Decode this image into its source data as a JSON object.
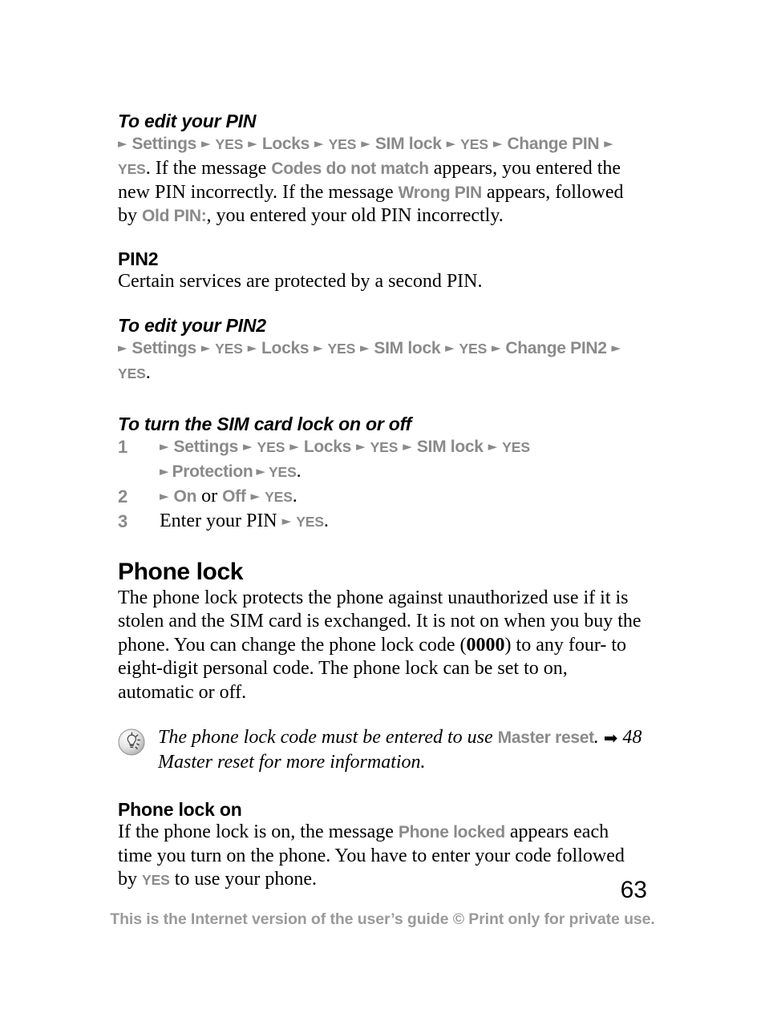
{
  "page": {
    "number": "63",
    "footer_note": "This is the Internet version of the user’s guide © Print only for private use."
  },
  "icons": {
    "menu_arrow": "►",
    "cross_reference_arrow": "➡",
    "tip": "lightbulb-tip-icon"
  },
  "colors": {
    "ui_gray": "#8a8a8a",
    "footer_gray": "#9a9a9a",
    "text_black": "#000000",
    "page_background": "#ffffff"
  },
  "sections": [
    {
      "id": "to-edit-your-pin",
      "heading": "To edit your PIN",
      "menu_path": [
        "Settings",
        "YES",
        "Locks",
        "YES",
        "SIM lock",
        "YES",
        "Change PIN",
        "YES"
      ],
      "body_parts": {
        "t1": ". If the message ",
        "m1": "Codes do not match",
        "t2": " appears, you entered the new PIN incorrectly. If the message ",
        "m2": "Wrong PIN",
        "t3": " appears, followed by ",
        "m3": "Old PIN:",
        "t4": ", you entered your old PIN incorrectly."
      }
    },
    {
      "id": "pin2",
      "heading": "PIN2",
      "body": "Certain services are protected by a second PIN."
    },
    {
      "id": "to-edit-your-pin2",
      "heading": "To edit your PIN2",
      "menu_path": [
        "Settings",
        "YES",
        "Locks",
        "YES",
        "SIM lock",
        "YES",
        "Change PIN2",
        "YES"
      ],
      "trailing": "."
    },
    {
      "id": "to-turn-sim-card-lock",
      "heading": "To turn the SIM card lock on or off",
      "steps": [
        {
          "number": "1",
          "menu_path": [
            "Settings",
            "YES",
            "Locks",
            "YES",
            "SIM lock",
            "YES"
          ],
          "menu_path_cont": [
            "Protection",
            "YES"
          ],
          "trailing": "."
        },
        {
          "number": "2",
          "option_a": "On",
          "conjunction": " or ",
          "option_b": "Off",
          "confirm": "YES",
          "trailing": "."
        },
        {
          "number": "3",
          "text": "Enter your PIN ",
          "confirm": "YES",
          "trailing": "."
        }
      ]
    },
    {
      "id": "phone-lock",
      "heading": "Phone lock",
      "body_parts": {
        "t1": "The phone lock protects the phone against unauthorized use if it is stolen and the SIM card is exchanged. It is not on when you buy the phone. You can change the phone lock code (",
        "code": "0000",
        "t2": ") to any four- to eight-digit personal code. The phone lock can be set to on, automatic or off."
      },
      "note": {
        "t1": "The phone lock code must be entered to use ",
        "m1": "Master reset",
        "t2": ". ",
        "reference": "48 Master reset for more information."
      }
    },
    {
      "id": "phone-lock-on",
      "heading": "Phone lock on",
      "body_parts": {
        "t1": "If the phone lock is on, the message ",
        "m1": "Phone locked",
        "t2": " appears each time you turn on the phone. You have to enter your code followed by ",
        "m2": "YES",
        "t3": " to use your phone."
      }
    }
  ]
}
